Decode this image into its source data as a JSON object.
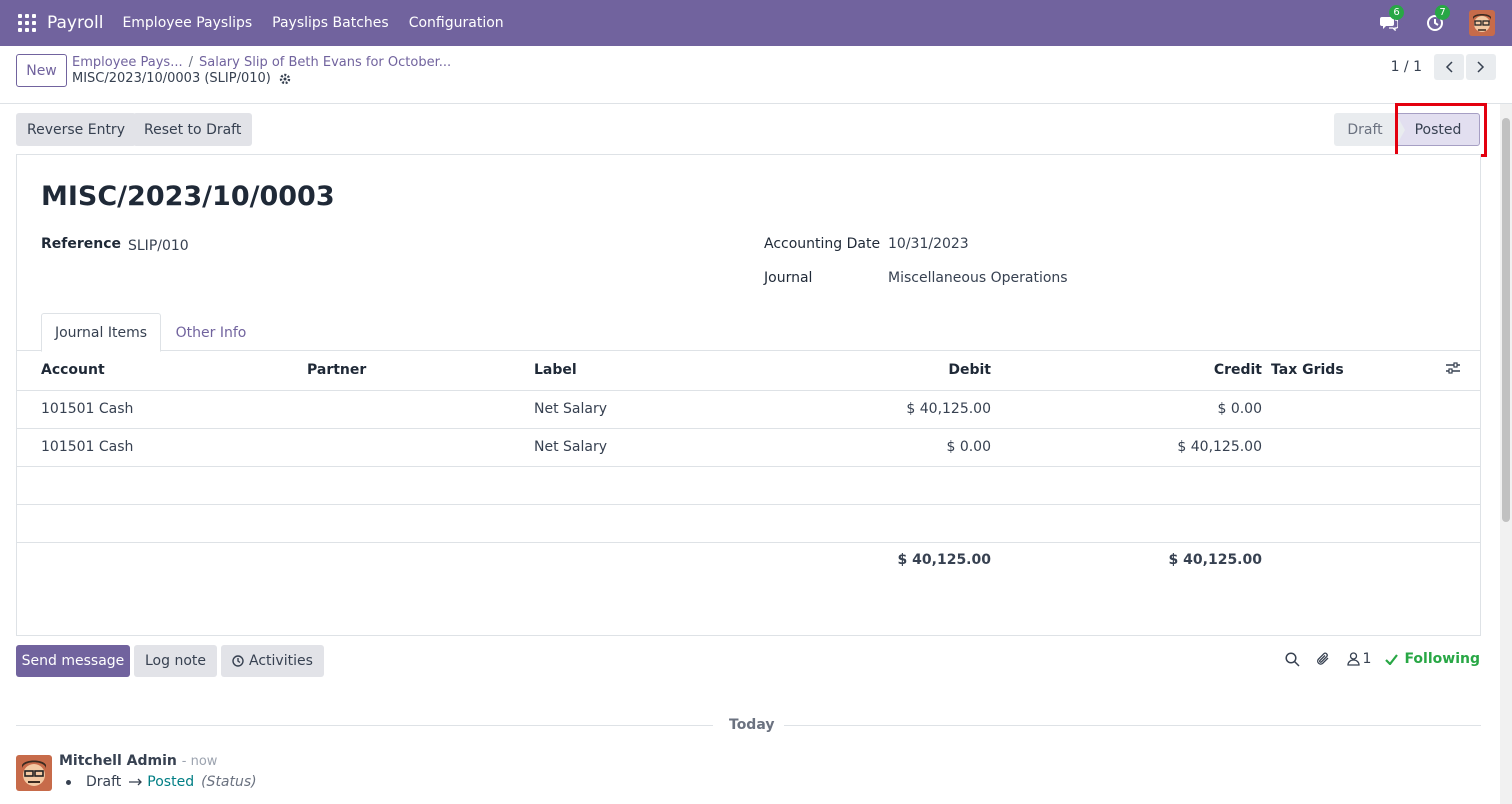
{
  "navbar": {
    "app_name": "Payroll",
    "menu": [
      "Employee Payslips",
      "Payslips Batches",
      "Configuration"
    ],
    "messages_count": "6",
    "activities_count": "7",
    "icons": [
      "apps-grid-icon",
      "chat-icon",
      "clock-icon",
      "user-avatar"
    ]
  },
  "breadcrumb": {
    "parent": "Employee Pays...",
    "middle": "Salary Slip of Beth Evans for October...",
    "current": "MISC/2023/10/0003 (SLIP/010)"
  },
  "control": {
    "new_label": "New",
    "pager": "1 / 1"
  },
  "actions": {
    "reverse_entry": "Reverse Entry",
    "reset_to_draft": "Reset to Draft"
  },
  "statusbar": {
    "draft": "Draft",
    "posted": "Posted",
    "active": "Posted"
  },
  "form": {
    "title": "MISC/2023/10/0003",
    "reference_label": "Reference",
    "reference_value": "SLIP/010",
    "accounting_date_label": "Accounting Date",
    "accounting_date_value": "10/31/2023",
    "journal_label": "Journal",
    "journal_value": "Miscellaneous Operations"
  },
  "tabs": {
    "journal_items": "Journal Items",
    "other_info": "Other Info"
  },
  "table": {
    "headers": {
      "account": "Account",
      "partner": "Partner",
      "label": "Label",
      "debit": "Debit",
      "credit": "Credit",
      "tax_grids": "Tax Grids"
    },
    "rows": [
      {
        "account": "101501 Cash",
        "partner": "",
        "label": "Net Salary",
        "debit": "$ 40,125.00",
        "credit": "$ 0.00",
        "tax_grids": ""
      },
      {
        "account": "101501 Cash",
        "partner": "",
        "label": "Net Salary",
        "debit": "$ 0.00",
        "credit": "$ 40,125.00",
        "tax_grids": ""
      }
    ],
    "totals": {
      "debit": "$ 40,125.00",
      "credit": "$ 40,125.00"
    }
  },
  "chatter": {
    "send_message": "Send message",
    "log_note": "Log note",
    "activities": "Activities",
    "followers_count": "1",
    "following": "Following",
    "divider_label": "Today",
    "message": {
      "author": "Mitchell Admin",
      "time": "- now",
      "old_value": "Draft",
      "new_value": "Posted",
      "field": "(Status)"
    }
  },
  "colors": {
    "brand": "#71639e",
    "success": "#28a745",
    "highlight": "#e3000f",
    "tracking_new": "#017e84"
  }
}
